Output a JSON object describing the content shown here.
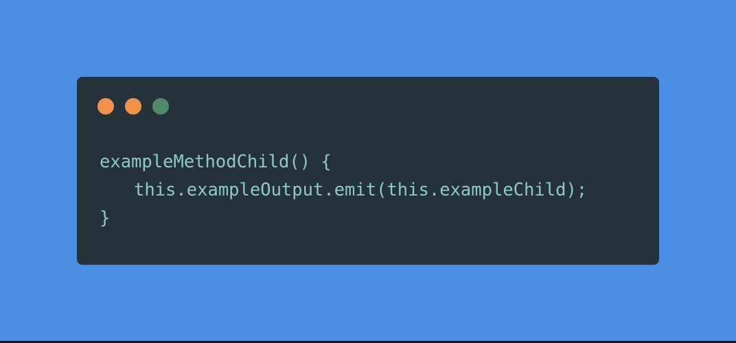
{
  "colors": {
    "background": "#4a8ee5",
    "window": "#263239",
    "code_text": "#8ccac8",
    "dot_close": "#f2914a",
    "dot_minimize": "#f2914a",
    "dot_maximize": "#4f8a6b",
    "bottom_border": "#111111"
  },
  "window_controls": [
    {
      "name": "close-dot",
      "color": "#f2914a"
    },
    {
      "name": "minimize-dot",
      "color": "#f2914a"
    },
    {
      "name": "maximize-dot",
      "color": "#4f8a6b"
    }
  ],
  "code": {
    "lines": [
      "exampleMethodChild() {",
      "this.exampleOutput.emit(this.exampleChild);",
      "}"
    ]
  }
}
